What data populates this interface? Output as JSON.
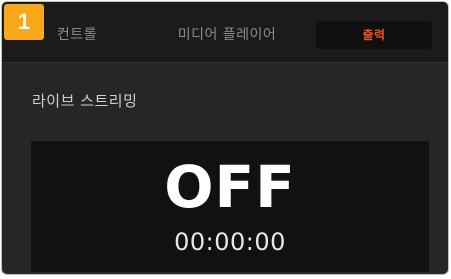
{
  "step_badge": "1",
  "tabs": [
    {
      "label": "컨트롤",
      "active": false
    },
    {
      "label": "미디어 플레이어",
      "active": false
    },
    {
      "label": "출력",
      "active": true
    }
  ],
  "section": {
    "title": "라이브 스트리밍"
  },
  "stream_status": {
    "state": "OFF",
    "timer": "00:00:00"
  },
  "colors": {
    "badge": "#f7a81b",
    "active_tab_text": "#d9532c",
    "background": "#262626"
  }
}
